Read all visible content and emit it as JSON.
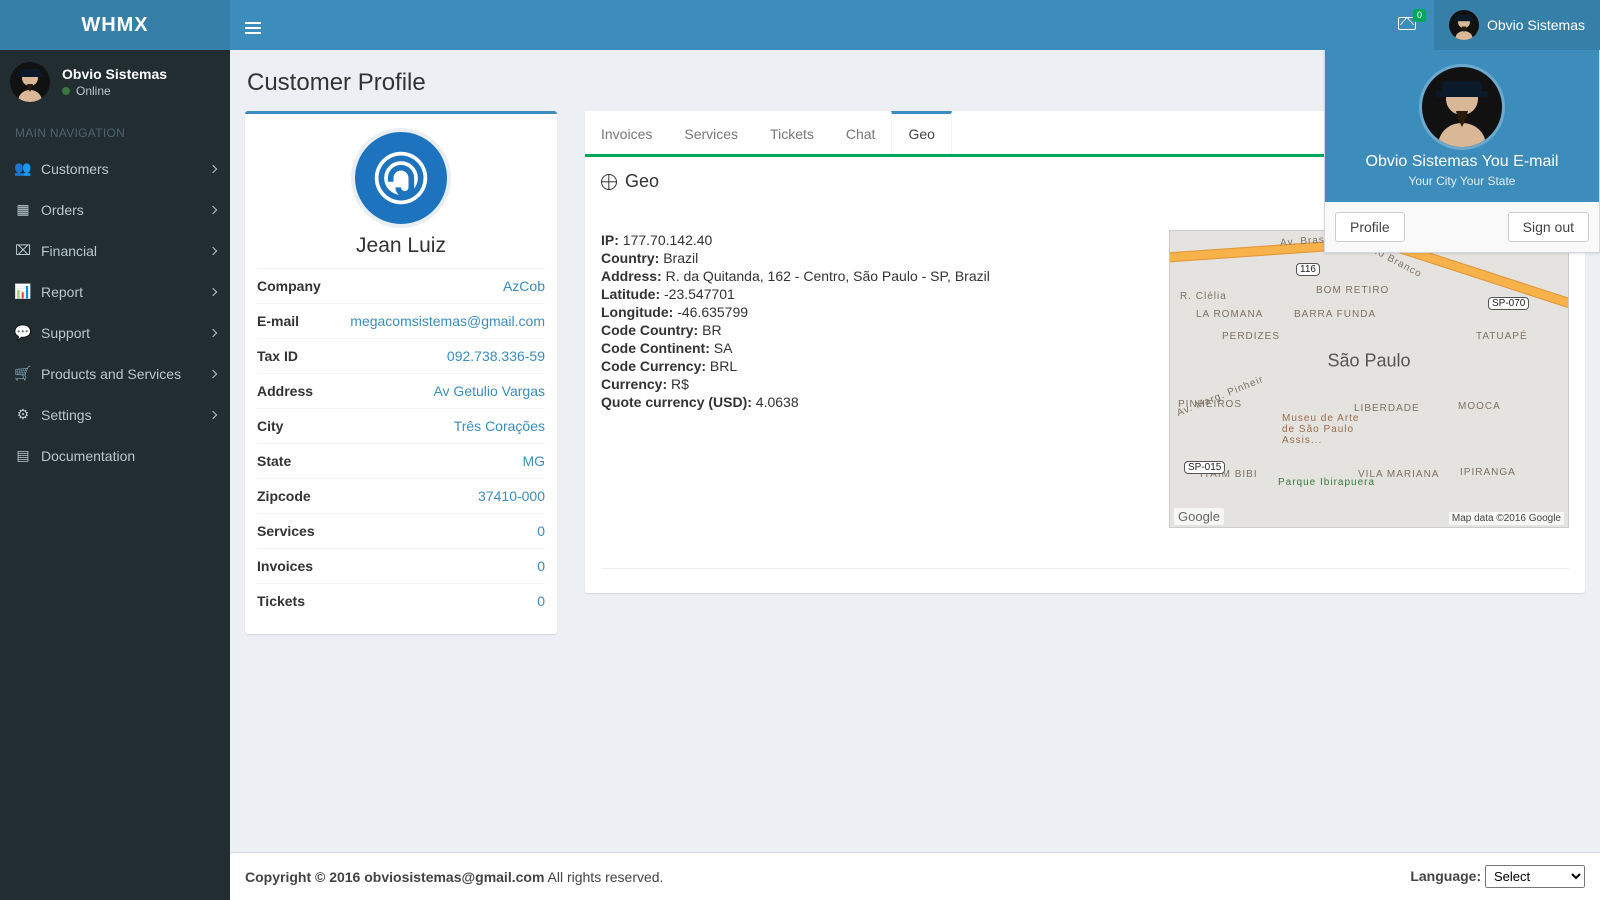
{
  "brand": "WHMX",
  "header": {
    "mail_count": "0",
    "user_name": "Obvio Sistemas"
  },
  "user_panel": {
    "name": "Obvio Sistemas",
    "status": "Online"
  },
  "nav_header": "MAIN NAVIGATION",
  "sidebar": {
    "items": [
      {
        "label": "Customers",
        "icon": "users-icon",
        "expandable": true
      },
      {
        "label": "Orders",
        "icon": "list-icon",
        "expandable": true
      },
      {
        "label": "Financial",
        "icon": "money-icon",
        "expandable": true
      },
      {
        "label": "Report",
        "icon": "chart-icon",
        "expandable": true
      },
      {
        "label": "Support",
        "icon": "comment-icon",
        "expandable": true
      },
      {
        "label": "Products and Services",
        "icon": "cart-icon",
        "expandable": true
      },
      {
        "label": "Settings",
        "icon": "cogs-icon",
        "expandable": true
      },
      {
        "label": "Documentation",
        "icon": "book-icon",
        "expandable": false
      }
    ]
  },
  "page_title": "Customer Profile",
  "customer": {
    "name": "Jean Luiz",
    "details": [
      {
        "label": "Company",
        "value": "AzCob"
      },
      {
        "label": "E-mail",
        "value": "megacomsistemas@gmail.com"
      },
      {
        "label": "Tax ID",
        "value": "092.738.336-59"
      },
      {
        "label": "Address",
        "value": "Av Getulio Vargas"
      },
      {
        "label": "City",
        "value": "Três Corações"
      },
      {
        "label": "State",
        "value": "MG"
      },
      {
        "label": "Zipcode",
        "value": "37410-000"
      },
      {
        "label": "Services",
        "value": "0"
      },
      {
        "label": "Invoices",
        "value": "0"
      },
      {
        "label": "Tickets",
        "value": "0"
      }
    ]
  },
  "tabs": [
    {
      "label": "Invoices",
      "active": false
    },
    {
      "label": "Services",
      "active": false
    },
    {
      "label": "Tickets",
      "active": false
    },
    {
      "label": "Chat",
      "active": false
    },
    {
      "label": "Geo",
      "active": true
    }
  ],
  "geo": {
    "title": "Geo",
    "fields": [
      {
        "label": "IP:",
        "value": "177.70.142.40"
      },
      {
        "label": "Country:",
        "value": "Brazil"
      },
      {
        "label": "Address:",
        "value": "R. da Quitanda, 162 - Centro, São Paulo - SP, Brazil"
      },
      {
        "label": "Latitude:",
        "value": "-23.547701"
      },
      {
        "label": "Longitude:",
        "value": "-46.635799"
      },
      {
        "label": "Code Country:",
        "value": "BR"
      },
      {
        "label": "Code Continent:",
        "value": "SA"
      },
      {
        "label": "Code Currency:",
        "value": "BRL"
      },
      {
        "label": "Currency:",
        "value": "R$"
      },
      {
        "label": "Quote currency (USD):",
        "value": "4.0638"
      }
    ],
    "map_city": "São Paulo",
    "map_attrib": "Map data ©2016 Google",
    "map_brand": "Google",
    "map_labels": [
      "R. Clélia",
      "LA ROMANA",
      "PERDIZES",
      "PINHEIROS",
      "ITAIM BIBI",
      "BOM RETIRO",
      "BARRA FUNDA",
      "Av. Marg. Pinheir",
      "Av. Rio Branco",
      "LIBERDADE",
      "MOOCA",
      "TATUAPÉ",
      "VILA MARIANA",
      "IPIRANGA",
      "Parque Ibirapuera",
      "Museu de Arte de São Paulo Assis...",
      "Av. Bras. Lime"
    ],
    "map_shields": [
      "116",
      "SP-015",
      "SP-070"
    ]
  },
  "dropdown": {
    "line1": "Obvio Sistemas You E-mail",
    "line2": "Your City Your State",
    "profile_btn": "Profile",
    "signout_btn": "Sign out"
  },
  "footer": {
    "copyright_bold": "Copyright © 2016 obviosistemas@gmail.com",
    "copyright_rest": " All rights reserved.",
    "language_label": "Language:",
    "language_selected": "Select"
  }
}
